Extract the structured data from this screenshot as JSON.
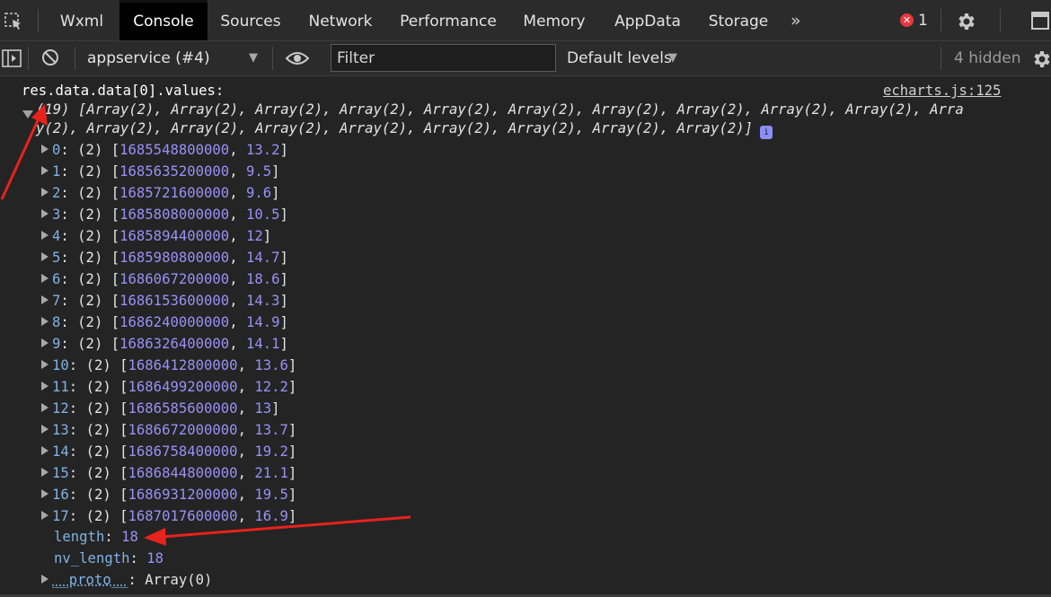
{
  "tabs": [
    {
      "label": "Wxml",
      "active": false
    },
    {
      "label": "Console",
      "active": true
    },
    {
      "label": "Sources",
      "active": false
    },
    {
      "label": "Network",
      "active": false
    },
    {
      "label": "Performance",
      "active": false
    },
    {
      "label": "Memory",
      "active": false
    },
    {
      "label": "AppData",
      "active": false
    },
    {
      "label": "Storage",
      "active": false
    }
  ],
  "more_tabs_glyph": "»",
  "errors": {
    "count": "1",
    "badge_glyph": "✕",
    "color": "#e8383d"
  },
  "toolbar": {
    "context": "appservice (#4)",
    "filter_placeholder": "Filter",
    "levels": "Default levels",
    "hidden": "4 hidden"
  },
  "console": {
    "label": "res.data.data[0].values:",
    "source": "echarts.js:125",
    "summary_line1": "(19) [Array(2), Array(2), Array(2), Array(2), Array(2), Array(2), Array(2), Array(2), Array(2), Array(2), Arra",
    "summary_line2": "y(2), Array(2), Array(2), Array(2), Array(2), Array(2), Array(2), Array(2), Array(2)]",
    "info_glyph": "i",
    "rows": [
      {
        "index": "0",
        "len": "(2)",
        "ts": "1685548800000",
        "val": "13.2"
      },
      {
        "index": "1",
        "len": "(2)",
        "ts": "1685635200000",
        "val": "9.5"
      },
      {
        "index": "2",
        "len": "(2)",
        "ts": "1685721600000",
        "val": "9.6"
      },
      {
        "index": "3",
        "len": "(2)",
        "ts": "1685808000000",
        "val": "10.5"
      },
      {
        "index": "4",
        "len": "(2)",
        "ts": "1685894400000",
        "val": "12"
      },
      {
        "index": "5",
        "len": "(2)",
        "ts": "1685980800000",
        "val": "14.7"
      },
      {
        "index": "6",
        "len": "(2)",
        "ts": "1686067200000",
        "val": "18.6"
      },
      {
        "index": "7",
        "len": "(2)",
        "ts": "1686153600000",
        "val": "14.3"
      },
      {
        "index": "8",
        "len": "(2)",
        "ts": "1686240000000",
        "val": "14.9"
      },
      {
        "index": "9",
        "len": "(2)",
        "ts": "1686326400000",
        "val": "14.1"
      },
      {
        "index": "10",
        "len": "(2)",
        "ts": "1686412800000",
        "val": "13.6"
      },
      {
        "index": "11",
        "len": "(2)",
        "ts": "1686499200000",
        "val": "12.2"
      },
      {
        "index": "12",
        "len": "(2)",
        "ts": "1686585600000",
        "val": "13"
      },
      {
        "index": "13",
        "len": "(2)",
        "ts": "1686672000000",
        "val": "13.7"
      },
      {
        "index": "14",
        "len": "(2)",
        "ts": "1686758400000",
        "val": "19.2"
      },
      {
        "index": "15",
        "len": "(2)",
        "ts": "1686844800000",
        "val": "21.1"
      },
      {
        "index": "16",
        "len": "(2)",
        "ts": "1686931200000",
        "val": "19.5"
      },
      {
        "index": "17",
        "len": "(2)",
        "ts": "1687017600000",
        "val": "16.9"
      }
    ],
    "length_label": "length",
    "length_value": "18",
    "nv_length_label": "nv_length",
    "nv_length_value": "18",
    "proto_label": "__proto__",
    "proto_value": "Array(0)"
  },
  "colors": {
    "index_key": "#7fb2e5",
    "number": "#9a90f5",
    "annotation_arrow": "#e8221c"
  }
}
